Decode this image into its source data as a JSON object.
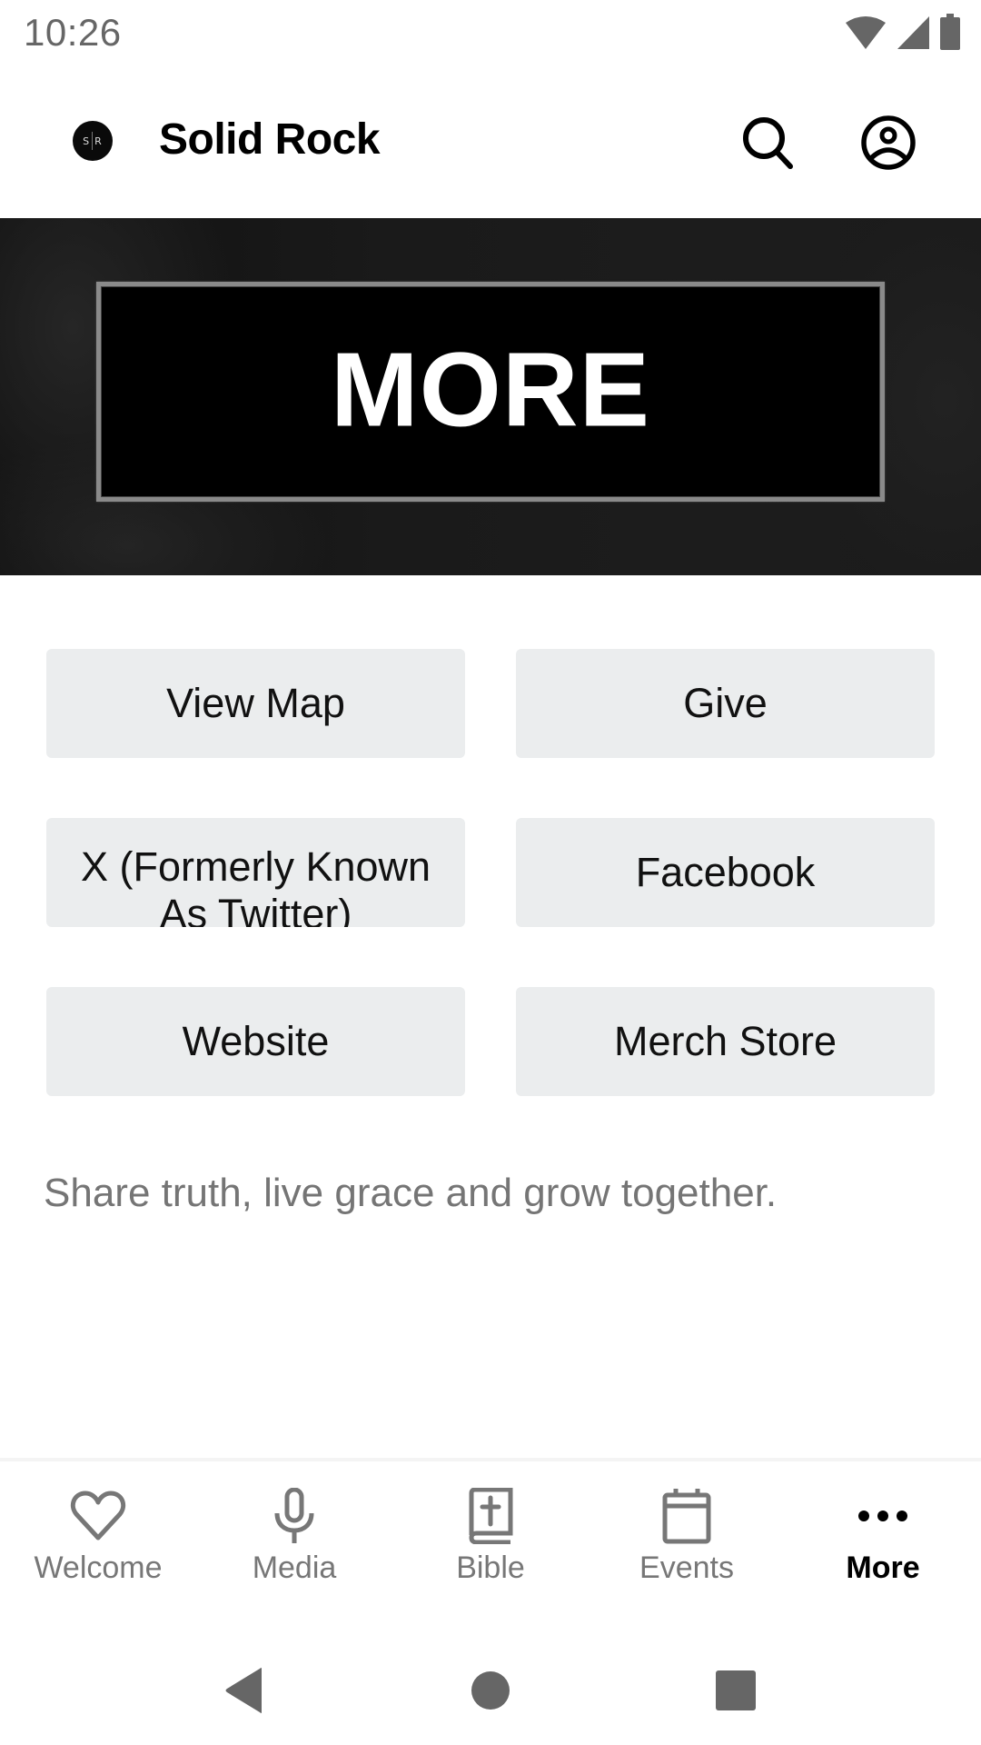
{
  "status_bar": {
    "time": "10:26",
    "icons": [
      "wifi-icon",
      "cellular-signal-icon",
      "battery-icon"
    ]
  },
  "app_bar": {
    "logo_text_left": "S",
    "logo_text_right": "R",
    "title": "Solid Rock",
    "actions": [
      "search-icon",
      "account-icon"
    ]
  },
  "banner": {
    "title": "MORE"
  },
  "links": [
    {
      "label": "View Map"
    },
    {
      "label": "Give"
    },
    {
      "label": "X (Formerly Known As Twitter)"
    },
    {
      "label": "Facebook"
    },
    {
      "label": "Website"
    },
    {
      "label": "Merch Store"
    }
  ],
  "tagline": "Share truth, live grace and grow together.",
  "bottom_nav": {
    "items": [
      {
        "label": "Welcome",
        "icon": "heart-icon",
        "active": false
      },
      {
        "label": "Media",
        "icon": "microphone-icon",
        "active": false
      },
      {
        "label": "Bible",
        "icon": "bible-icon",
        "active": false
      },
      {
        "label": "Events",
        "icon": "calendar-icon",
        "active": false
      },
      {
        "label": "More",
        "icon": "more-horizontal-icon",
        "active": true
      }
    ]
  },
  "system_nav": [
    "back-icon",
    "home-icon",
    "recents-icon"
  ],
  "colors": {
    "button_bg": "#ebedee",
    "inactive_nav": "#777777",
    "active_nav": "#000000",
    "tagline": "#757575"
  }
}
